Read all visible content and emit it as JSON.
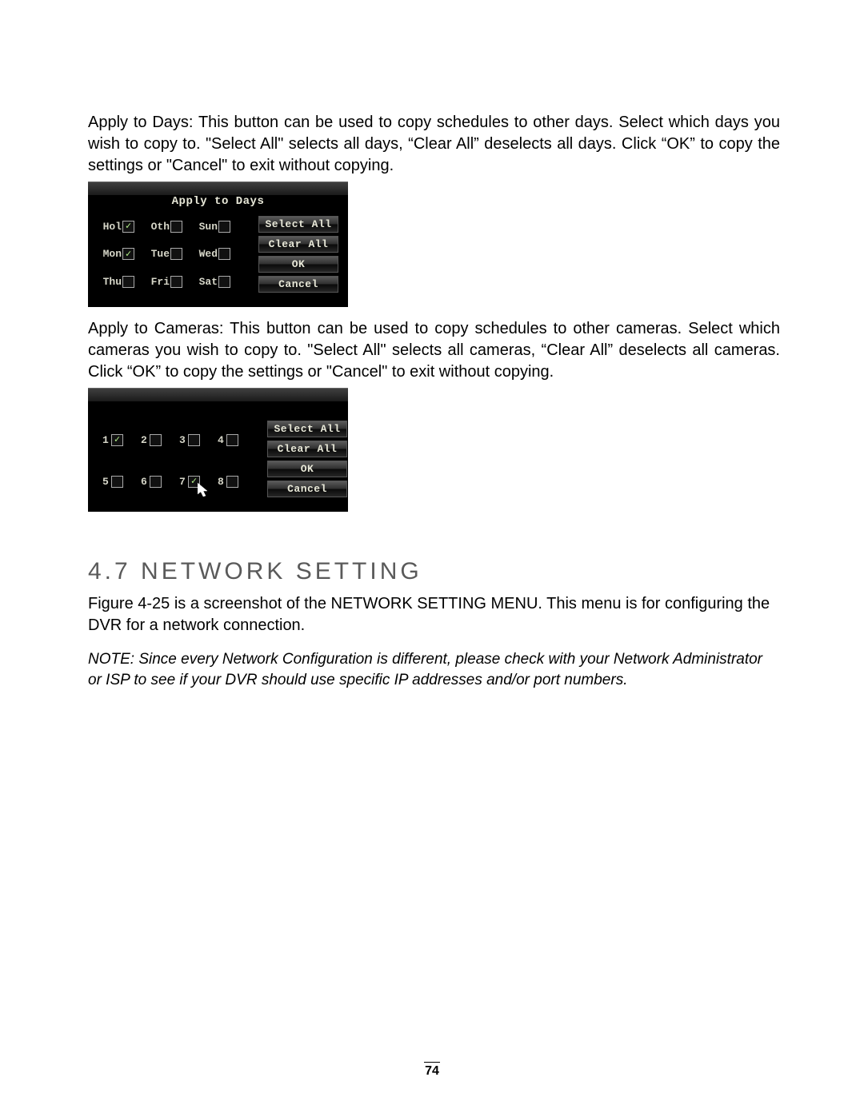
{
  "paragraphs": {
    "apply_days_text": "Apply to Days: This button can be used to copy schedules to other days. Select which days you wish to copy to. \"Select All\" selects all days, “Clear All” deselects all days. Click “OK” to copy the settings or \"Cancel\" to exit without copying.",
    "apply_cameras_text": "Apply to Cameras: This button can be used to copy schedules to other cameras. Select which cameras you wish to copy to. \"Select All\" selects all cameras, “Clear All” deselects all cameras. Click “OK” to copy the settings or \"Cancel\" to exit without copying.",
    "figure_intro": "Figure 4-25 is a screenshot of the NETWORK SETTING MENU. This menu is for configuring the DVR for a network connection.",
    "note_text": "NOTE: Since every Network Configuration is different, please check with your Network Administrator or ISP to see if your DVR should use specific IP addresses and/or port numbers."
  },
  "section_heading": "4.7  NETWORK SETTING",
  "days_dialog": {
    "title": "Apply to Days",
    "items": [
      {
        "label": "Hol",
        "checked": true
      },
      {
        "label": "Oth",
        "checked": false
      },
      {
        "label": "Sun",
        "checked": false
      },
      {
        "label": "Mon",
        "checked": true
      },
      {
        "label": "Tue",
        "checked": false
      },
      {
        "label": "Wed",
        "checked": false
      },
      {
        "label": "Thu",
        "checked": false
      },
      {
        "label": "Fri",
        "checked": false
      },
      {
        "label": "Sat",
        "checked": false
      }
    ],
    "buttons": {
      "select_all": "Select All",
      "clear_all": "Clear All",
      "ok": "OK",
      "cancel": "Cancel"
    }
  },
  "cameras_dialog": {
    "items": [
      {
        "label": "1",
        "checked": true
      },
      {
        "label": "2",
        "checked": false
      },
      {
        "label": "3",
        "checked": false
      },
      {
        "label": "4",
        "checked": false
      },
      {
        "label": "5",
        "checked": false
      },
      {
        "label": "6",
        "checked": false
      },
      {
        "label": "7",
        "checked": true
      },
      {
        "label": "8",
        "checked": false
      }
    ],
    "buttons": {
      "select_all": "Select All",
      "clear_all": "Clear All",
      "ok": "OK",
      "cancel": "Cancel"
    }
  },
  "page_number": "74"
}
